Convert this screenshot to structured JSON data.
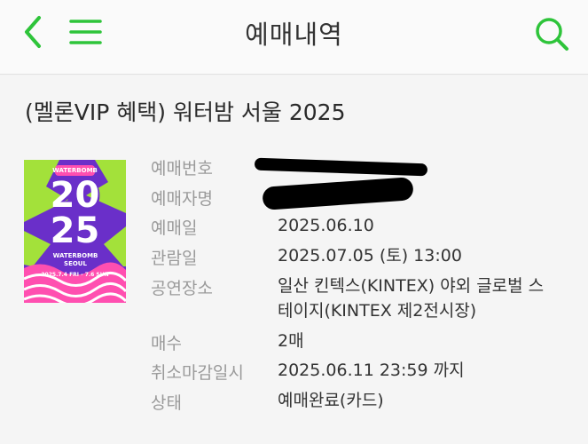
{
  "header": {
    "title": "예매내역",
    "back_icon": "chevron-left-icon",
    "menu_icon": "hamburger-menu-icon",
    "search_icon": "search-icon",
    "accent_color": "#2ec43a"
  },
  "booking": {
    "event_title": "(멜론VIP 혜택) 워터밤 서울 2025",
    "poster": {
      "brand": "WATERBOMB",
      "year_top": "20",
      "year_bottom": "25",
      "subtitle": "WATERBOMB SEOUL",
      "dates": "2025.7.4 FRI - 7.6 SUN"
    },
    "details": [
      {
        "label": "예매번호",
        "value": ""
      },
      {
        "label": "예매자명",
        "value": ""
      },
      {
        "label": "예매일",
        "value": "2025.06.10"
      },
      {
        "label": "관람일",
        "value": "2025.07.05 (토) 13:00"
      },
      {
        "label": "공연장소",
        "value_line1": "일산 킨텍스(KINTEX) 야외 글로벌 스",
        "value_line2": "테이지(KINTEX 제2전시장)"
      },
      {
        "label": "매수",
        "value": "2매"
      },
      {
        "label": "취소마감일시",
        "value": "2025.06.11 23:59 까지"
      },
      {
        "label": "상태",
        "value": "예매완료(카드)"
      }
    ]
  }
}
